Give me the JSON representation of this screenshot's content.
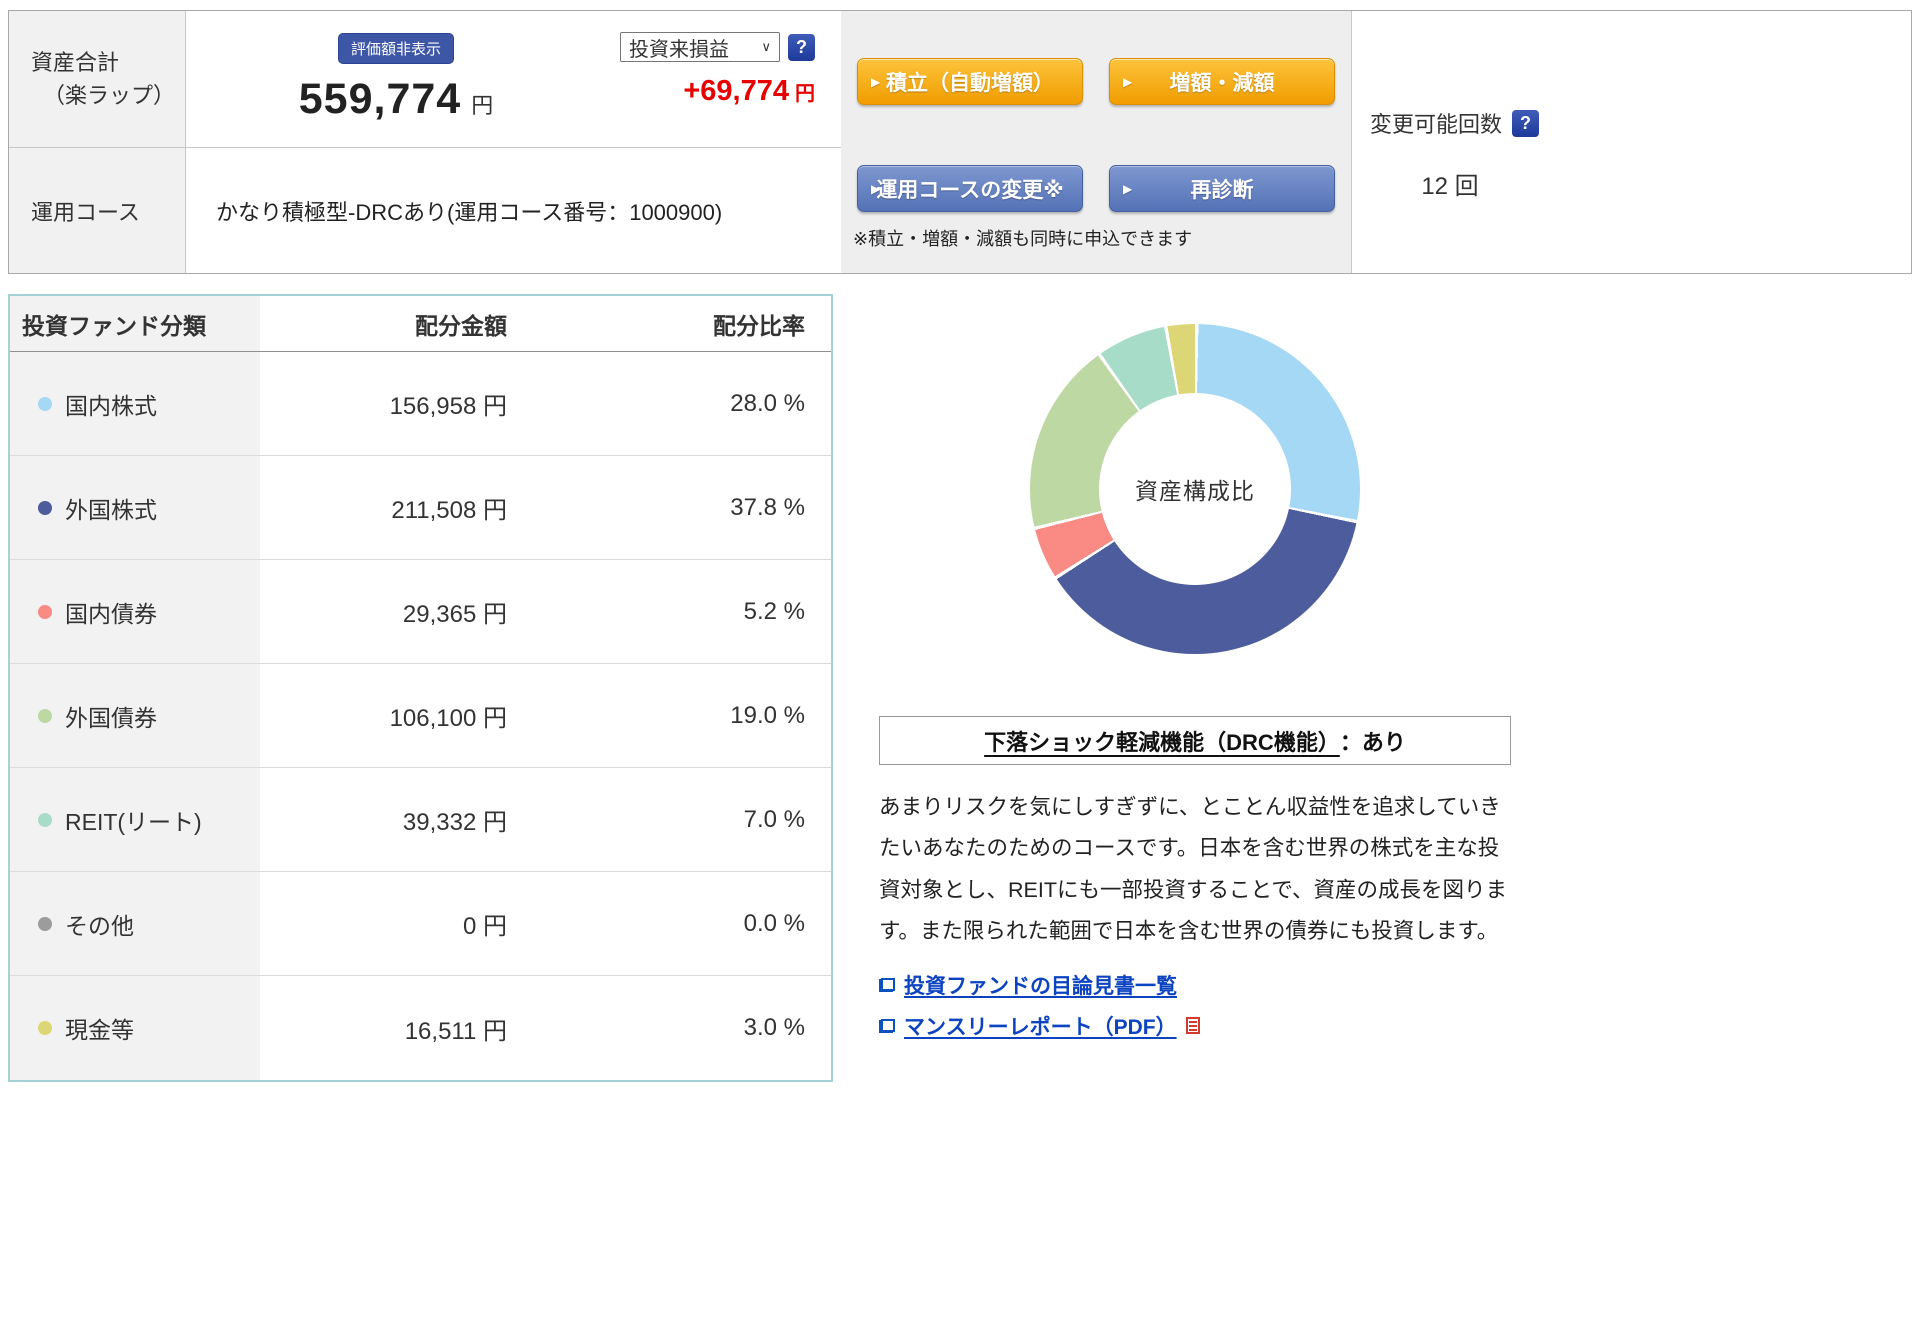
{
  "icons": {
    "help": "?",
    "chevron_down": "∨",
    "button_arrow": "▶"
  },
  "summary": {
    "asset_label_line1": "資産合計",
    "asset_label_line2": "（楽ラップ）",
    "hide_value_button": "評価額非表示",
    "total_amount": "559,774",
    "total_amount_unit": "円",
    "profit_select_value": "投資来損益",
    "profit_amount": "+69,774",
    "profit_unit": "円",
    "btn_tsumitate": "積立（自動増額）",
    "btn_zougen": "増額・減額",
    "course_label": "運用コース",
    "course_value": "かなり積極型-DRCあり(運用コース番号：1000900)",
    "btn_course_change": "運用コースの変更※",
    "btn_rediagnosis": "再診断",
    "note": "※積立・増額・減額も同時に申込できます",
    "change_count_label": "変更可能回数",
    "change_count_value": "12 回"
  },
  "allocation_table": {
    "headers": [
      "投資ファンド分類",
      "配分金額",
      "配分比率"
    ],
    "rows": [
      {
        "label": "国内株式",
        "color": "#a4d8f4",
        "amount": "156,958 円",
        "ratio": "28.0 %"
      },
      {
        "label": "外国株式",
        "color": "#4d5c9d",
        "amount": "211,508 円",
        "ratio": "37.8 %"
      },
      {
        "label": "国内債券",
        "color": "#f98b84",
        "amount": "29,365 円",
        "ratio": "5.2 %"
      },
      {
        "label": "外国債券",
        "color": "#bdd8a3",
        "amount": "106,100 円",
        "ratio": "19.0 %"
      },
      {
        "label": "REIT(リート)",
        "color": "#a7dcc9",
        "amount": "39,332 円",
        "ratio": "7.0 %"
      },
      {
        "label": "その他",
        "color": "#9c9c9c",
        "amount": "0 円",
        "ratio": "0.0 %"
      },
      {
        "label": "現金等",
        "color": "#ddd677",
        "amount": "16,511 円",
        "ratio": "3.0 %"
      }
    ]
  },
  "chart_data": {
    "type": "pie",
    "donut": true,
    "start": "top-clockwise",
    "center_label": "資産構成比",
    "labels": [
      "国内株式",
      "外国株式",
      "国内債券",
      "外国債券",
      "REIT(リート)",
      "その他",
      "現金等"
    ],
    "values": [
      28.0,
      37.8,
      5.2,
      19.0,
      7.0,
      0.0,
      3.0
    ],
    "colors": [
      "#a4d8f4",
      "#4d5c9d",
      "#f98b84",
      "#bdd8a3",
      "#a7dcc9",
      "#9c9c9c",
      "#ddd677"
    ]
  },
  "drc": {
    "title": "下落ショック軽減機能（DRC機能）",
    "title_suffix": "：あり",
    "description": "あまりリスクを気にしすぎずに、とことん収益性を追求していきたいあなたのためのコースです。日本を含む世界の株式を主な投資対象とし、REITにも一部投資することで、資産の成長を図ります。また限られた範囲で日本を含む世界の債券にも投資します。",
    "links": [
      {
        "label": "投資ファンドの目論見書一覧"
      },
      {
        "label": "マンスリーレポート（PDF）"
      }
    ]
  }
}
